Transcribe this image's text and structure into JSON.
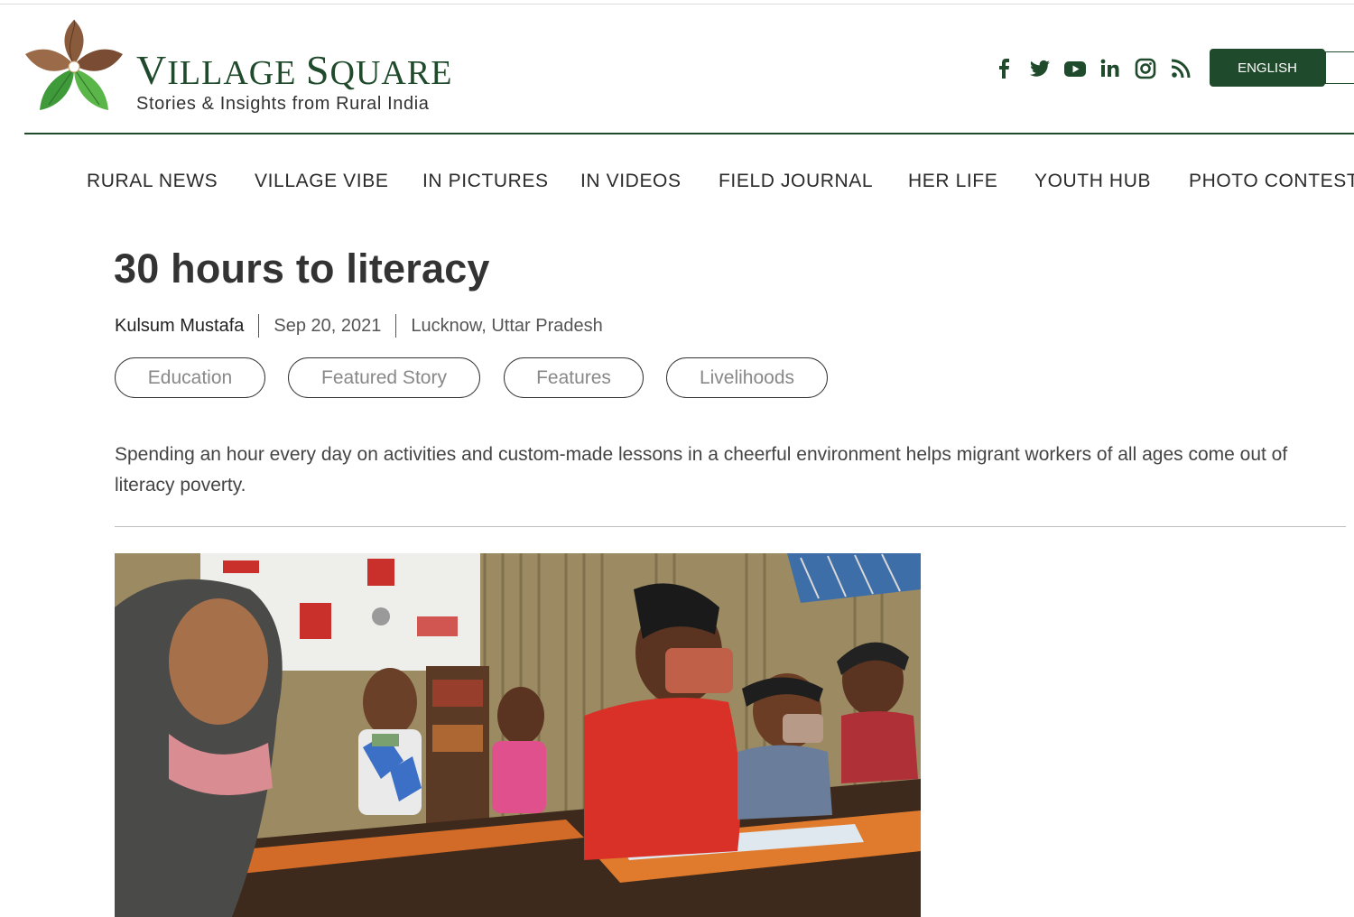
{
  "brand": {
    "title_first_letter": "V",
    "title_rest_1": "ILLAGE ",
    "title_second_letter": "S",
    "title_rest_2": "QUARE",
    "tagline": "Stories & Insights from Rural India"
  },
  "social": [
    "facebook-icon",
    "twitter-icon",
    "youtube-icon",
    "linkedin-icon",
    "instagram-icon",
    "rss-icon"
  ],
  "language_button": "ENGLISH",
  "nav": {
    "items": [
      "RURAL NEWS",
      "VILLAGE VIBE",
      "IN PICTURES",
      "IN VIDEOS",
      "FIELD JOURNAL",
      "HER LIFE",
      "YOUTH HUB",
      "PHOTO CONTEST"
    ]
  },
  "article": {
    "title": "30 hours to literacy",
    "author": "Kulsum Mustafa",
    "date": "Sep 20, 2021",
    "location": "Lucknow, Uttar Pradesh",
    "tags": [
      "Education",
      "Featured Story",
      "Features",
      "Livelihoods"
    ],
    "summary": "Spending an hour every day on activities and custom-made lessons in a cheerful environment helps migrant workers of all ages come out of literacy poverty."
  },
  "colors": {
    "brand_green": "#1f4a2b",
    "leaf_brown": "#8a5a3c",
    "leaf_green": "#3f9a3a"
  }
}
